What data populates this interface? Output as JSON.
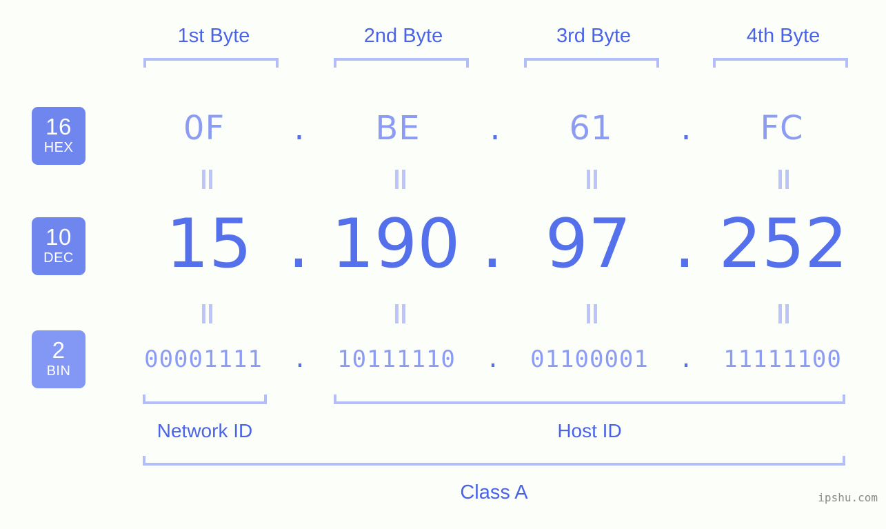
{
  "background_color": "#fcfefa",
  "accent_color": "#5470ea",
  "accent_light_color": "#8c9cf3",
  "bracket_color": "#b3bdf8",
  "badge_color": "#6f86ef",
  "header": {
    "byte_labels": [
      {
        "label": "1st Byte"
      },
      {
        "label": "2nd Byte"
      },
      {
        "label": "3rd Byte"
      },
      {
        "label": "4th Byte"
      }
    ]
  },
  "rows": [
    {
      "badge_number": "16",
      "badge_radix": "HEX",
      "values": [
        "0F",
        "BE",
        "61",
        "FC"
      ],
      "separator": "."
    },
    {
      "badge_number": "10",
      "badge_radix": "DEC",
      "values": [
        "15",
        "190",
        "97",
        "252"
      ],
      "separator": "."
    },
    {
      "badge_number": "2",
      "badge_radix": "BIN",
      "values": [
        "00001111",
        "10111110",
        "01100001",
        "11111100"
      ],
      "separator": "."
    }
  ],
  "equals_glyph": "=",
  "footer": {
    "network_id_label": "Network ID",
    "host_id_label": "Host ID",
    "class_label": "Class A",
    "watermark": "ipshu.com"
  }
}
